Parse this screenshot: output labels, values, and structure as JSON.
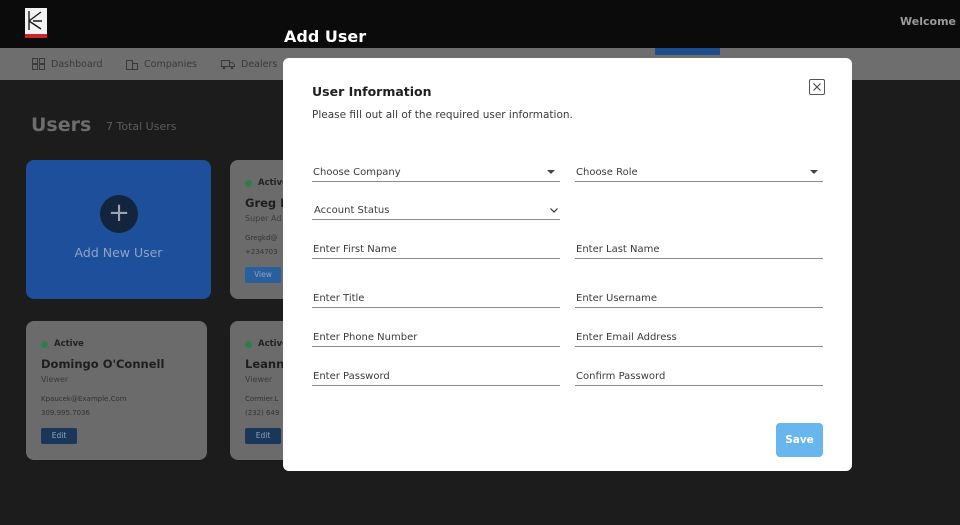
{
  "header": {
    "welcome": "Welcome",
    "modal_heading": "Add User"
  },
  "nav": {
    "items": [
      {
        "label": "Dashboard",
        "icon": "dashboard-icon"
      },
      {
        "label": "Companies",
        "icon": "companies-icon"
      },
      {
        "label": "Dealers",
        "icon": "dealers-icon"
      }
    ]
  },
  "page": {
    "title": "Users",
    "count": "7 Total Users",
    "add_new": "Add New User",
    "add_icon": "+"
  },
  "cards": [
    {
      "status": "Active",
      "name": "Greg K",
      "role": "Super Ad",
      "email": "Gregkd@",
      "phone": "+234703",
      "button": "View"
    },
    {
      "status": "Active",
      "name": "Domingo O'Connell",
      "role": "Viewer",
      "email": "Kpaucek@Example.Com",
      "phone": "309.995.7036",
      "button": "Edit"
    },
    {
      "status": "Active",
      "name": "Leann",
      "role": "Viewer",
      "email": "Cormier.L",
      "phone": "(232) 649",
      "button": "Edit"
    }
  ],
  "modal": {
    "title": "User Information",
    "subtitle": "Please fill out all of the required user information.",
    "fields": {
      "company": "Choose Company",
      "role": "Choose Role",
      "account_status": "Account Status",
      "first_name": "Enter First Name",
      "last_name": "Enter Last Name",
      "title": "Enter Title",
      "username": "Enter Username",
      "phone": "Enter Phone Number",
      "email": "Enter Email Address",
      "password": "Enter Password",
      "confirm_password": "Confirm Password"
    },
    "save": "Save"
  },
  "colors": {
    "accent": "#68b6ee",
    "nav_active": "#1f4e8c",
    "add_card": "#1d4f9a",
    "status_active": "#2e7d4f"
  }
}
